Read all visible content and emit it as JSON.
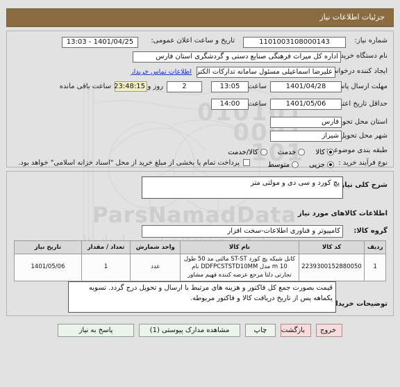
{
  "header": {
    "title": "جزئیات اطلاعات نیاز",
    "bar_color": "#8a6c40"
  },
  "top_panel": {
    "need_number": {
      "label": "شماره نیاز:",
      "value": "1101003108000143"
    },
    "public_announce": {
      "label": "تاریخ و ساعت اعلان عمومی:",
      "value": "1401/04/25 - 13:03"
    },
    "buyer_org": {
      "label": "نام دستگاه خریدار:",
      "value": "اداره کل میراث فرهنگی  صنایع دستی و گردشگری استان فارس"
    },
    "requester": {
      "label": "ایجاد کننده درخواست:",
      "value": "علیرضا اسماعیلی مسئول سامانه تدارکات الکترونیکی اداره کل میراث فرهنگی"
    },
    "contact_link": "اطلاعات تماس خریدار",
    "response_deadline": {
      "label": "مهلت ارسال پاسخ: تا تاریخ:",
      "date": "1401/04/28",
      "time_label": "ساعت",
      "time": "13:05",
      "days": "2",
      "days_label": "روز و",
      "countdown": "23:48:15",
      "countdown_label": "ساعت باقی مانده"
    },
    "price_validity": {
      "label": "حداقل تاریخ اعتبار قیمت: تا تاریخ:",
      "date": "1401/05/06",
      "time_label": "ساعت",
      "time": "14:00"
    },
    "delivery_province": {
      "label": "استان محل تحویل:",
      "value": "فارس"
    },
    "delivery_city": {
      "label": "شهر محل تحویل:",
      "value": "شیراز"
    },
    "category": {
      "label": "طبقه بندی موضوعی:",
      "options": [
        "کالا",
        "خدمت",
        "کالا/خدمت"
      ],
      "selected": "کالا"
    },
    "purchase_type": {
      "label": "نوع فرآیند خرید :",
      "options": [
        "جزیی",
        "متوسط"
      ],
      "selected": "جزیی",
      "checkbox_label": "پرداخت تمام یا بخشی از مبلغ خرید از محل \"اسناد خزانه اسلامی\" خواهد بود.",
      "checkbox_checked": false
    }
  },
  "middle_panel": {
    "need_summary": {
      "label": "شرح کلی نیاز:",
      "value": "پچ کورد و سی دی و مولتی متر"
    },
    "goods_section_title": "اطلاعات کالاهای مورد نیاز",
    "goods_group": {
      "label": "گروه کالا:",
      "value": "کامپیوتر و فناوری اطلاعات-سخت افزار"
    },
    "table": {
      "headers": [
        "ردیف",
        "کد کالا",
        "نام کالا",
        "واحد شمارش",
        "تعداد / مقدار",
        "تاریخ نیاز"
      ],
      "rows": [
        {
          "row_no": "1",
          "code": "2239300152880050",
          "name": "کابل شبکه پچ کورد ST-ST مالتی مد 50 طول 10 m مدل DDFPCSTSTD10MM نام تجارتی دلتا مرجع عرضه کننده فهیم مشاور",
          "unit": "عدد",
          "quantity": "1",
          "need_date": "1401/05/06"
        }
      ]
    },
    "buyer_notes": {
      "label": "توضیحات خریدار:",
      "value": "قیمت بصورت جمع کل فاکتور و هزینه های مرتبط با ارسال و تحویل درج گردد. تسویه یکماهه پس از تاریخ دریافت کالا و فاکتور مربوطه."
    }
  },
  "footer_buttons": [
    {
      "label": "پاسخ به نیاز",
      "style": "green"
    },
    {
      "label": "مشاهده مدارک پیوستی (1)",
      "style": "green"
    },
    {
      "label": "چاپ",
      "style": "plain"
    },
    {
      "label": "بازگشت",
      "style": "red"
    },
    {
      "label": "خروج",
      "style": "red"
    }
  ],
  "watermark": {
    "digits": "010101\n0001\n101",
    "brand": "ParsNamadData",
    "line_fa1": "مرکز فراوری اطلاعات پارس نماد داده‌ها",
    "line_fa2": "بانک اطلاعات مناقصه و مزایده",
    "line_phone": "۰۲۱-۸۸۳۴۶۹۶۷"
  }
}
